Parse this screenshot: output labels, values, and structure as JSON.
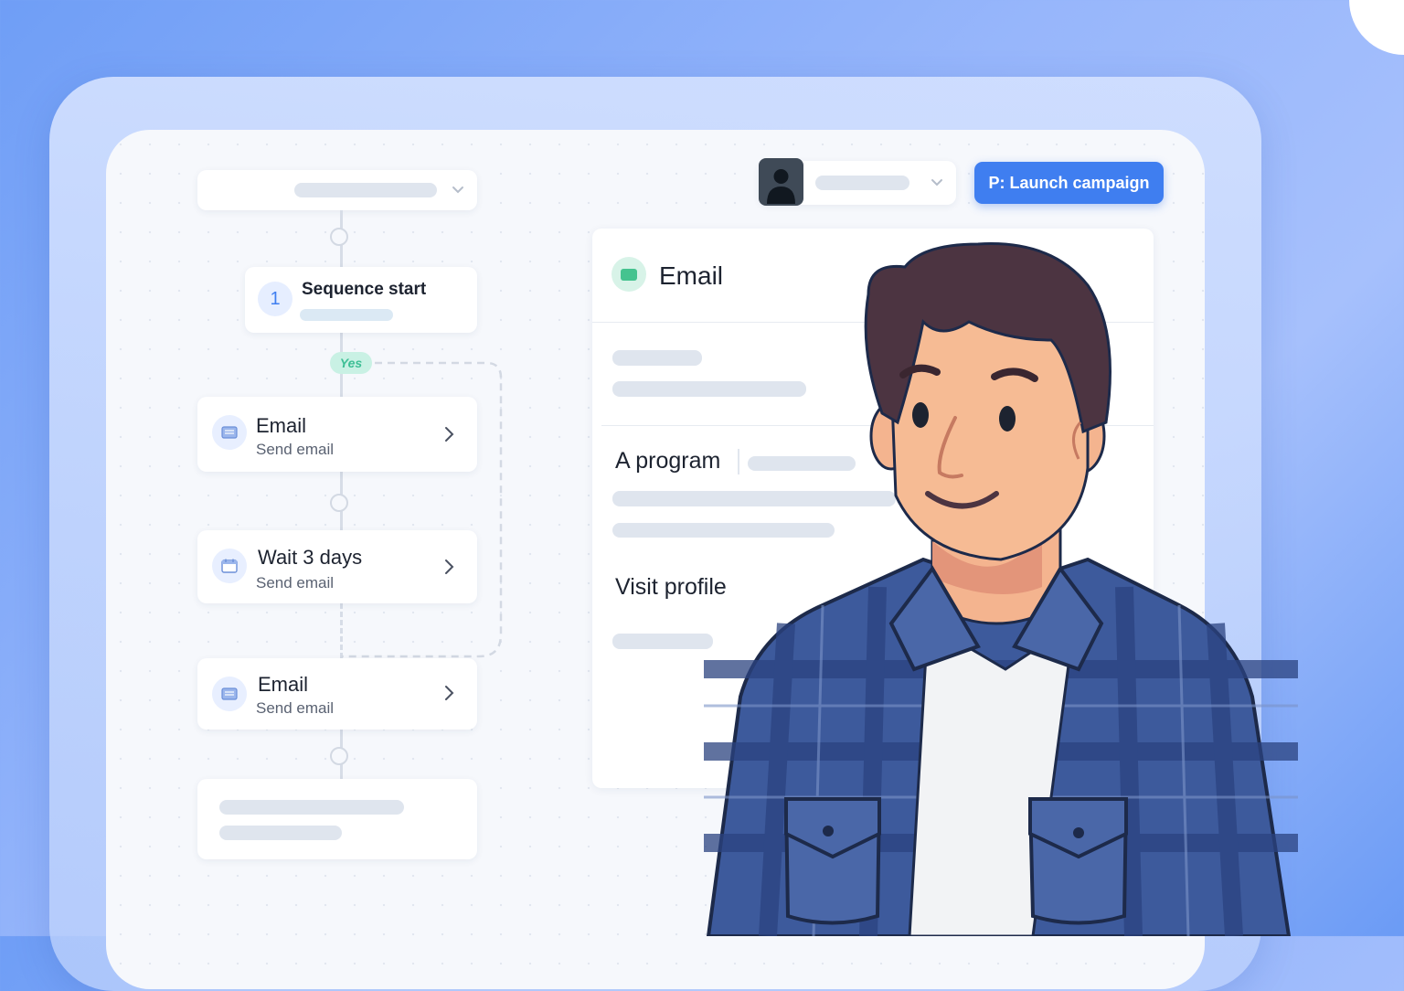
{
  "header": {
    "launch_button_label": "P: Launch campaign",
    "accent_color": "#3f7ef0"
  },
  "sequence": {
    "start": {
      "number": "1",
      "title": "Sequence start"
    },
    "branch_label": "Yes",
    "steps": [
      {
        "title": "Email",
        "subtitle": "Send email",
        "icon": "email-icon"
      },
      {
        "title": "Wait 3 days",
        "subtitle": "Send email",
        "icon": "calendar-icon"
      },
      {
        "title": "Email",
        "subtitle": "Send email",
        "icon": "email-icon"
      }
    ]
  },
  "detail_panel": {
    "title": "Email",
    "program_label": "A program",
    "visit_profile_label": "Visit profile",
    "icon": "email-status-icon"
  },
  "illustration": {
    "subject": "person-illustration"
  }
}
